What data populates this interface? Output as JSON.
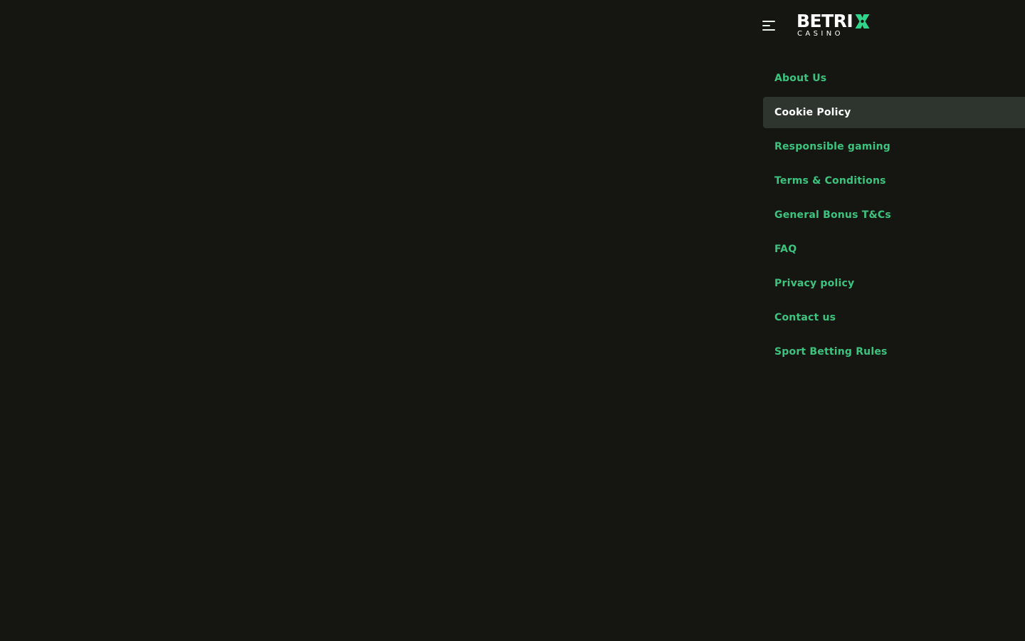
{
  "header": {
    "menu_icon": "hamburger-menu-icon",
    "logo": {
      "wordmark": "BETRI",
      "mark_icon": "x-clover-icon",
      "subtitle": "CASINO"
    }
  },
  "nav": {
    "items": [
      {
        "label": "About Us",
        "active": false
      },
      {
        "label": "Cookie Policy",
        "active": true
      },
      {
        "label": "Responsible gaming",
        "active": false
      },
      {
        "label": "Terms & Conditions",
        "active": false
      },
      {
        "label": "General Bonus T&Cs",
        "active": false
      },
      {
        "label": "FAQ",
        "active": false
      },
      {
        "label": "Privacy policy",
        "active": false
      },
      {
        "label": "Contact us",
        "active": false
      },
      {
        "label": "Sport Betting Rules",
        "active": false
      }
    ]
  },
  "colors": {
    "background": "#151611",
    "accent": "#3cc47f",
    "active_bg": "#2e352f",
    "active_text": "#ffffff"
  }
}
